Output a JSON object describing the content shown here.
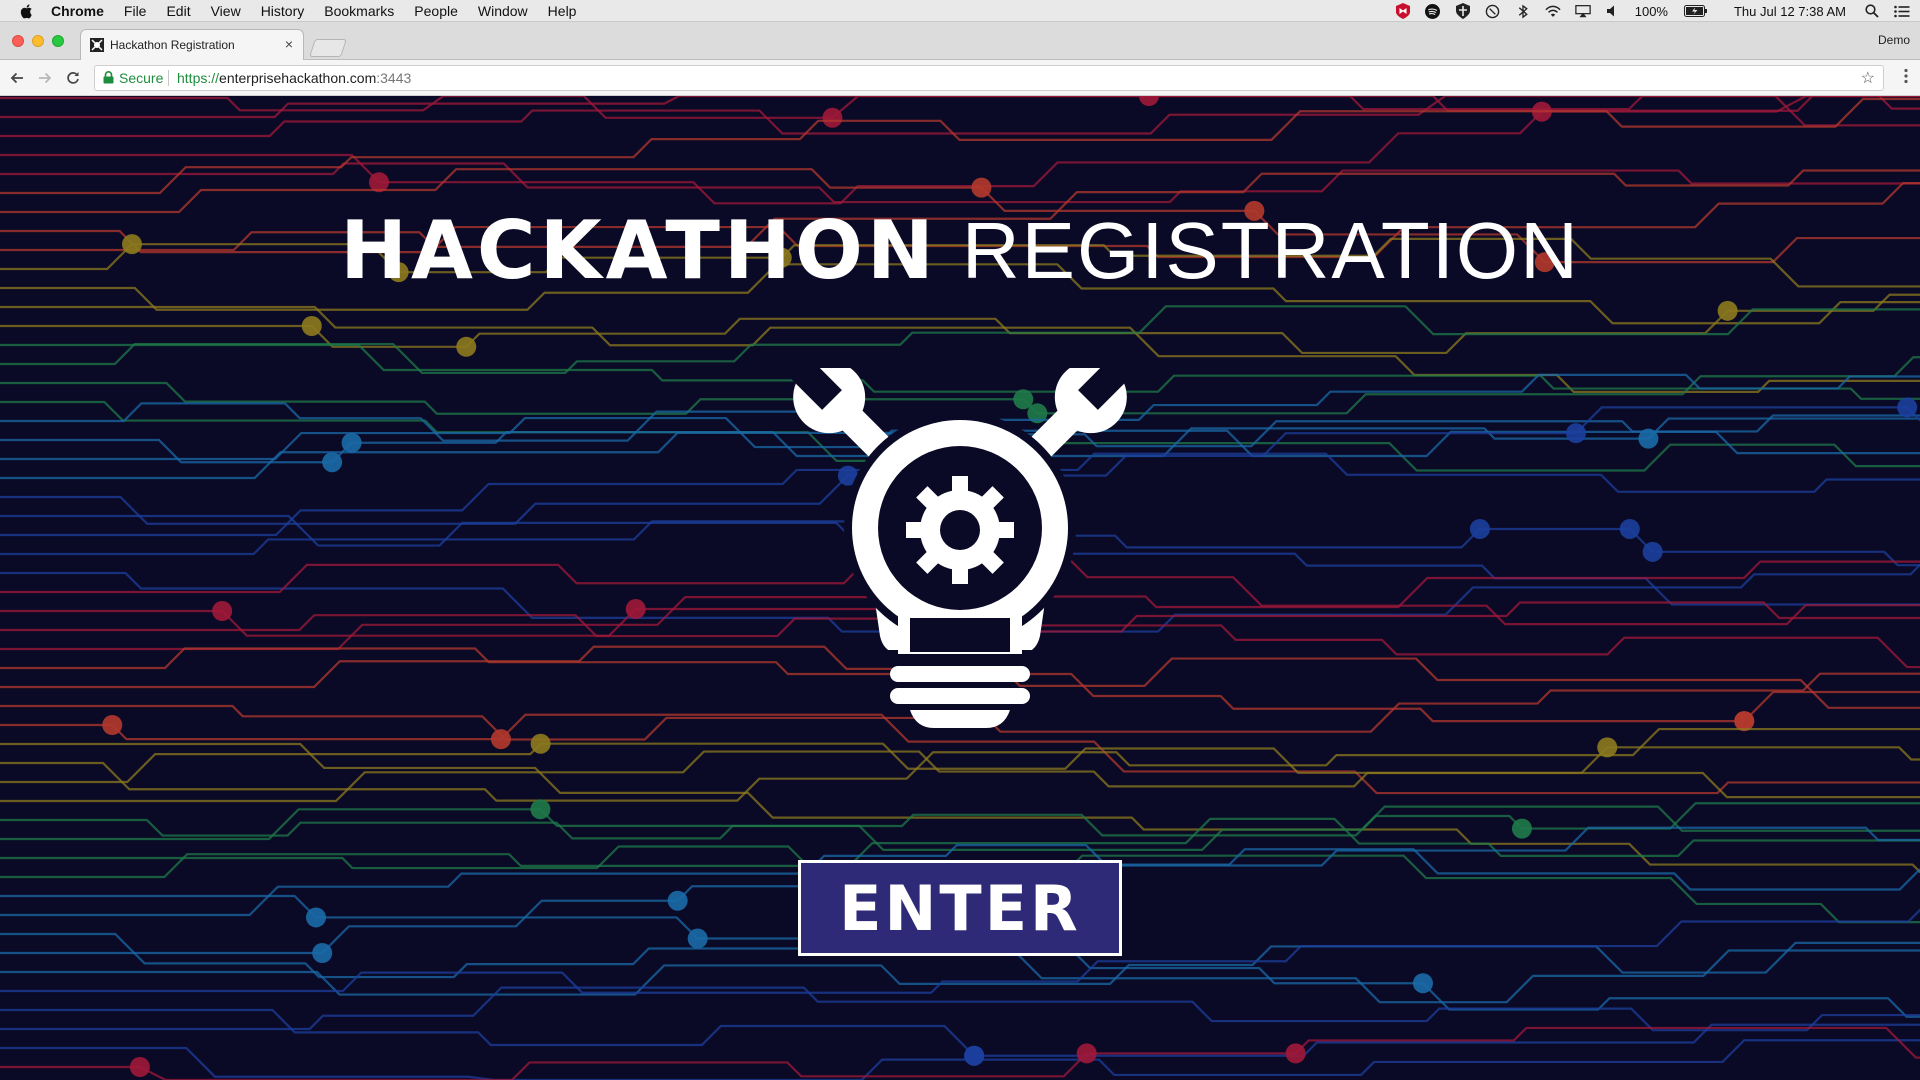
{
  "menubar": {
    "apple_icon": "apple-icon",
    "items": [
      "Chrome",
      "File",
      "Edit",
      "View",
      "History",
      "Bookmarks",
      "People",
      "Window",
      "Help"
    ],
    "status_icons": [
      "mcafee-icon",
      "spotify-icon",
      "shield-icon",
      "magnifier-icon",
      "bluetooth-icon",
      "wifi-icon",
      "airplay-icon",
      "volume-icon"
    ],
    "battery_percent": "100%",
    "datetime": "Thu Jul 12  7:38 AM",
    "status_end_icons": [
      "spotlight-search-icon",
      "notification-center-icon"
    ]
  },
  "browser": {
    "tab_title": "Hackathon Registration",
    "tab_close": "×",
    "profile_name": "Demo",
    "secure_label": "Secure",
    "url_scheme": "https://",
    "url_host": "enterprisehackathon.com",
    "url_port": ":3443"
  },
  "page": {
    "heading_bold": "HACKATHON",
    "heading_light": "REGISTRATION",
    "enter_label": "ENTER",
    "logo_icon": "lightbulb-gear-wrenches-icon"
  },
  "colors": {
    "background": "#0b0a26",
    "button": "#2f2a78",
    "circuit": [
      "#a0183a",
      "#b3382e",
      "#8c7a1e",
      "#1f7a4a",
      "#1a6aa8",
      "#1c3f9e"
    ]
  }
}
